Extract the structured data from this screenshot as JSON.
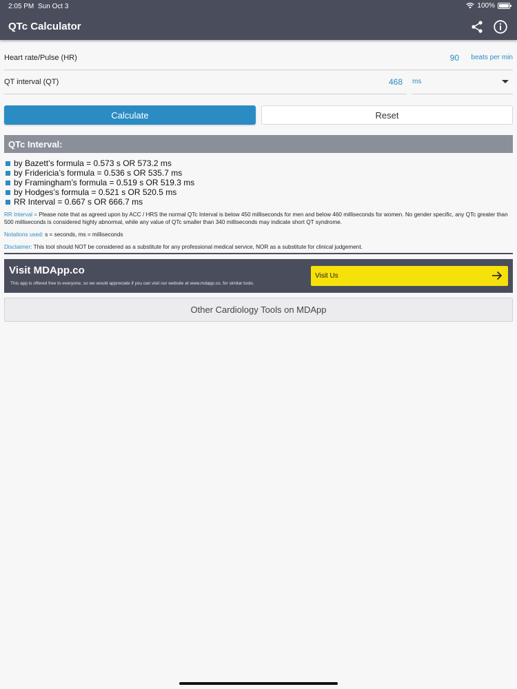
{
  "status_bar": {
    "time": "2:05 PM",
    "date": "Sun Oct 3",
    "battery": "100%"
  },
  "app_bar": {
    "title": "QTc Calculator",
    "icons": [
      "share-icon",
      "info-icon"
    ]
  },
  "form": {
    "hr": {
      "label": "Heart rate/Pulse (HR)",
      "value": "90",
      "unit": "beats per min"
    },
    "qt": {
      "label": "QT interval (QT)",
      "value": "468",
      "unit": "ms"
    }
  },
  "buttons": {
    "calculate": "Calculate",
    "reset": "Reset"
  },
  "result": {
    "header": "QTc Interval:",
    "lines": [
      "by Bazett’s formula = 0.573 s OR 573.2 ms",
      "by Fridericia’s formula = 0.536 s OR 535.7 ms",
      "by Framingham’s formula = 0.519 s OR 519.3 ms",
      "by Hodges’s formula = 0.521 s OR 520.5 ms",
      "RR Interval = 0.667 s OR 666.7 ms"
    ]
  },
  "notes": {
    "rr_key": "RR Interval =",
    "rr_text": "Please note that as agreed upon by ACC / HRS the normal QTc Interval is below 450 milliseconds for men and below 460 milliseconds for women. No gender specific, any QTc greater than 500 milliseconds is considered highly abnormal, while any value of QTc smaller than 340 milliseconds may indicate short QT syndrome.",
    "notation_key": "Notations used:",
    "notation_text": "s = seconds, ms = milliseconds",
    "disclaimer_key": "Disclaimer:",
    "disclaimer_text": "This tool should NOT be considered as a substitute for any professional medical service, NOR as a substitute for clinical judgement."
  },
  "visit": {
    "title": "Visit MDApp.co",
    "subtitle": "This app is offered free to everyone, so we would appreciate if you can visit our website at www.mdapp.co, for similar tools.",
    "button": "Visit Us"
  },
  "other_tools": "Other Cardiology Tools on MDApp",
  "colors": {
    "accent": "#2b8cc4",
    "bar": "#4a4e5c",
    "visit_button": "#f7e10a",
    "result_header": "#8a8f9a"
  }
}
